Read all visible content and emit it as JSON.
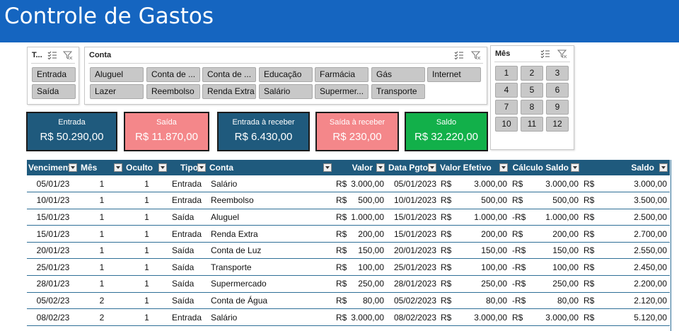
{
  "header": {
    "title": "Controle de Gastos"
  },
  "slicers": {
    "tipo": {
      "title": "T...",
      "items": [
        "Entrada",
        "Saída"
      ]
    },
    "conta": {
      "title": "Conta",
      "items": [
        "Aluguel",
        "Conta de ...",
        "Conta de ...",
        "Educação",
        "Farmácia",
        "Gás",
        "Internet",
        "Lazer",
        "Reembolso",
        "Renda Extra",
        "Salário",
        "Supermer...",
        "Transporte"
      ]
    },
    "mes": {
      "title": "Mês",
      "items": [
        "1",
        "2",
        "3",
        "4",
        "5",
        "6",
        "7",
        "8",
        "9",
        "10",
        "11",
        "12"
      ]
    }
  },
  "cards": [
    {
      "label": "Entrada",
      "value": "R$ 50.290,00",
      "color": "#1f5a7d"
    },
    {
      "label": "Saída",
      "value": "R$ 11.870,00",
      "color": "#f4878a"
    },
    {
      "label": "Entrada à receber",
      "value": "R$ 6.430,00",
      "color": "#1f5a7d"
    },
    {
      "label": "Saída à receber",
      "value": "R$ 230,00",
      "color": "#f4878a"
    },
    {
      "label": "Saldo",
      "value": "R$ 32.220,00",
      "color": "#12b04a"
    }
  ],
  "table": {
    "columns": [
      "Venciment",
      "Mês",
      "Oculto",
      "Tipo",
      "Conta",
      "Valor",
      "Data Pgto",
      "Valor Efetivo",
      "Cálculo Saldo",
      "Saldo"
    ],
    "rows": [
      {
        "venc": "05/01/23",
        "mes": "1",
        "oculto": "1",
        "tipo": "Entrada",
        "conta": "Salário",
        "valor": "3.000,00",
        "pgto": "05/01/2023",
        "efetivo": "3.000,00",
        "calc_sign": "R$",
        "calc": "3.000,00",
        "saldo": "3.000,00"
      },
      {
        "venc": "10/01/23",
        "mes": "1",
        "oculto": "1",
        "tipo": "Entrada",
        "conta": "Reembolso",
        "valor": "500,00",
        "pgto": "10/01/2023",
        "efetivo": "500,00",
        "calc_sign": "R$",
        "calc": "500,00",
        "saldo": "3.500,00"
      },
      {
        "venc": "15/01/23",
        "mes": "1",
        "oculto": "1",
        "tipo": "Saída",
        "conta": "Aluguel",
        "valor": "1.000,00",
        "pgto": "15/01/2023",
        "efetivo": "1.000,00",
        "calc_sign": "-R$",
        "calc": "1.000,00",
        "saldo": "2.500,00"
      },
      {
        "venc": "15/01/23",
        "mes": "1",
        "oculto": "1",
        "tipo": "Entrada",
        "conta": "Renda Extra",
        "valor": "200,00",
        "pgto": "15/01/2023",
        "efetivo": "200,00",
        "calc_sign": "R$",
        "calc": "200,00",
        "saldo": "2.700,00"
      },
      {
        "venc": "20/01/23",
        "mes": "1",
        "oculto": "1",
        "tipo": "Saída",
        "conta": "Conta de Luz",
        "valor": "150,00",
        "pgto": "20/01/2023",
        "efetivo": "150,00",
        "calc_sign": "-R$",
        "calc": "150,00",
        "saldo": "2.550,00"
      },
      {
        "venc": "25/01/23",
        "mes": "1",
        "oculto": "1",
        "tipo": "Saída",
        "conta": "Transporte",
        "valor": "100,00",
        "pgto": "25/01/2023",
        "efetivo": "100,00",
        "calc_sign": "-R$",
        "calc": "100,00",
        "saldo": "2.450,00"
      },
      {
        "venc": "28/01/23",
        "mes": "1",
        "oculto": "1",
        "tipo": "Saída",
        "conta": "Supermercado",
        "valor": "250,00",
        "pgto": "28/01/2023",
        "efetivo": "250,00",
        "calc_sign": "-R$",
        "calc": "250,00",
        "saldo": "2.200,00"
      },
      {
        "venc": "05/02/23",
        "mes": "2",
        "oculto": "1",
        "tipo": "Saída",
        "conta": "Conta de Água",
        "valor": "80,00",
        "pgto": "05/02/2023",
        "efetivo": "80,00",
        "calc_sign": "-R$",
        "calc": "80,00",
        "saldo": "2.120,00"
      },
      {
        "venc": "08/02/23",
        "mes": "2",
        "oculto": "1",
        "tipo": "Entrada",
        "conta": "Salário",
        "valor": "3.000,00",
        "pgto": "08/02/2023",
        "efetivo": "3.000,00",
        "calc_sign": "R$",
        "calc": "3.000,00",
        "saldo": "5.120,00"
      }
    ],
    "currency": "R$"
  }
}
